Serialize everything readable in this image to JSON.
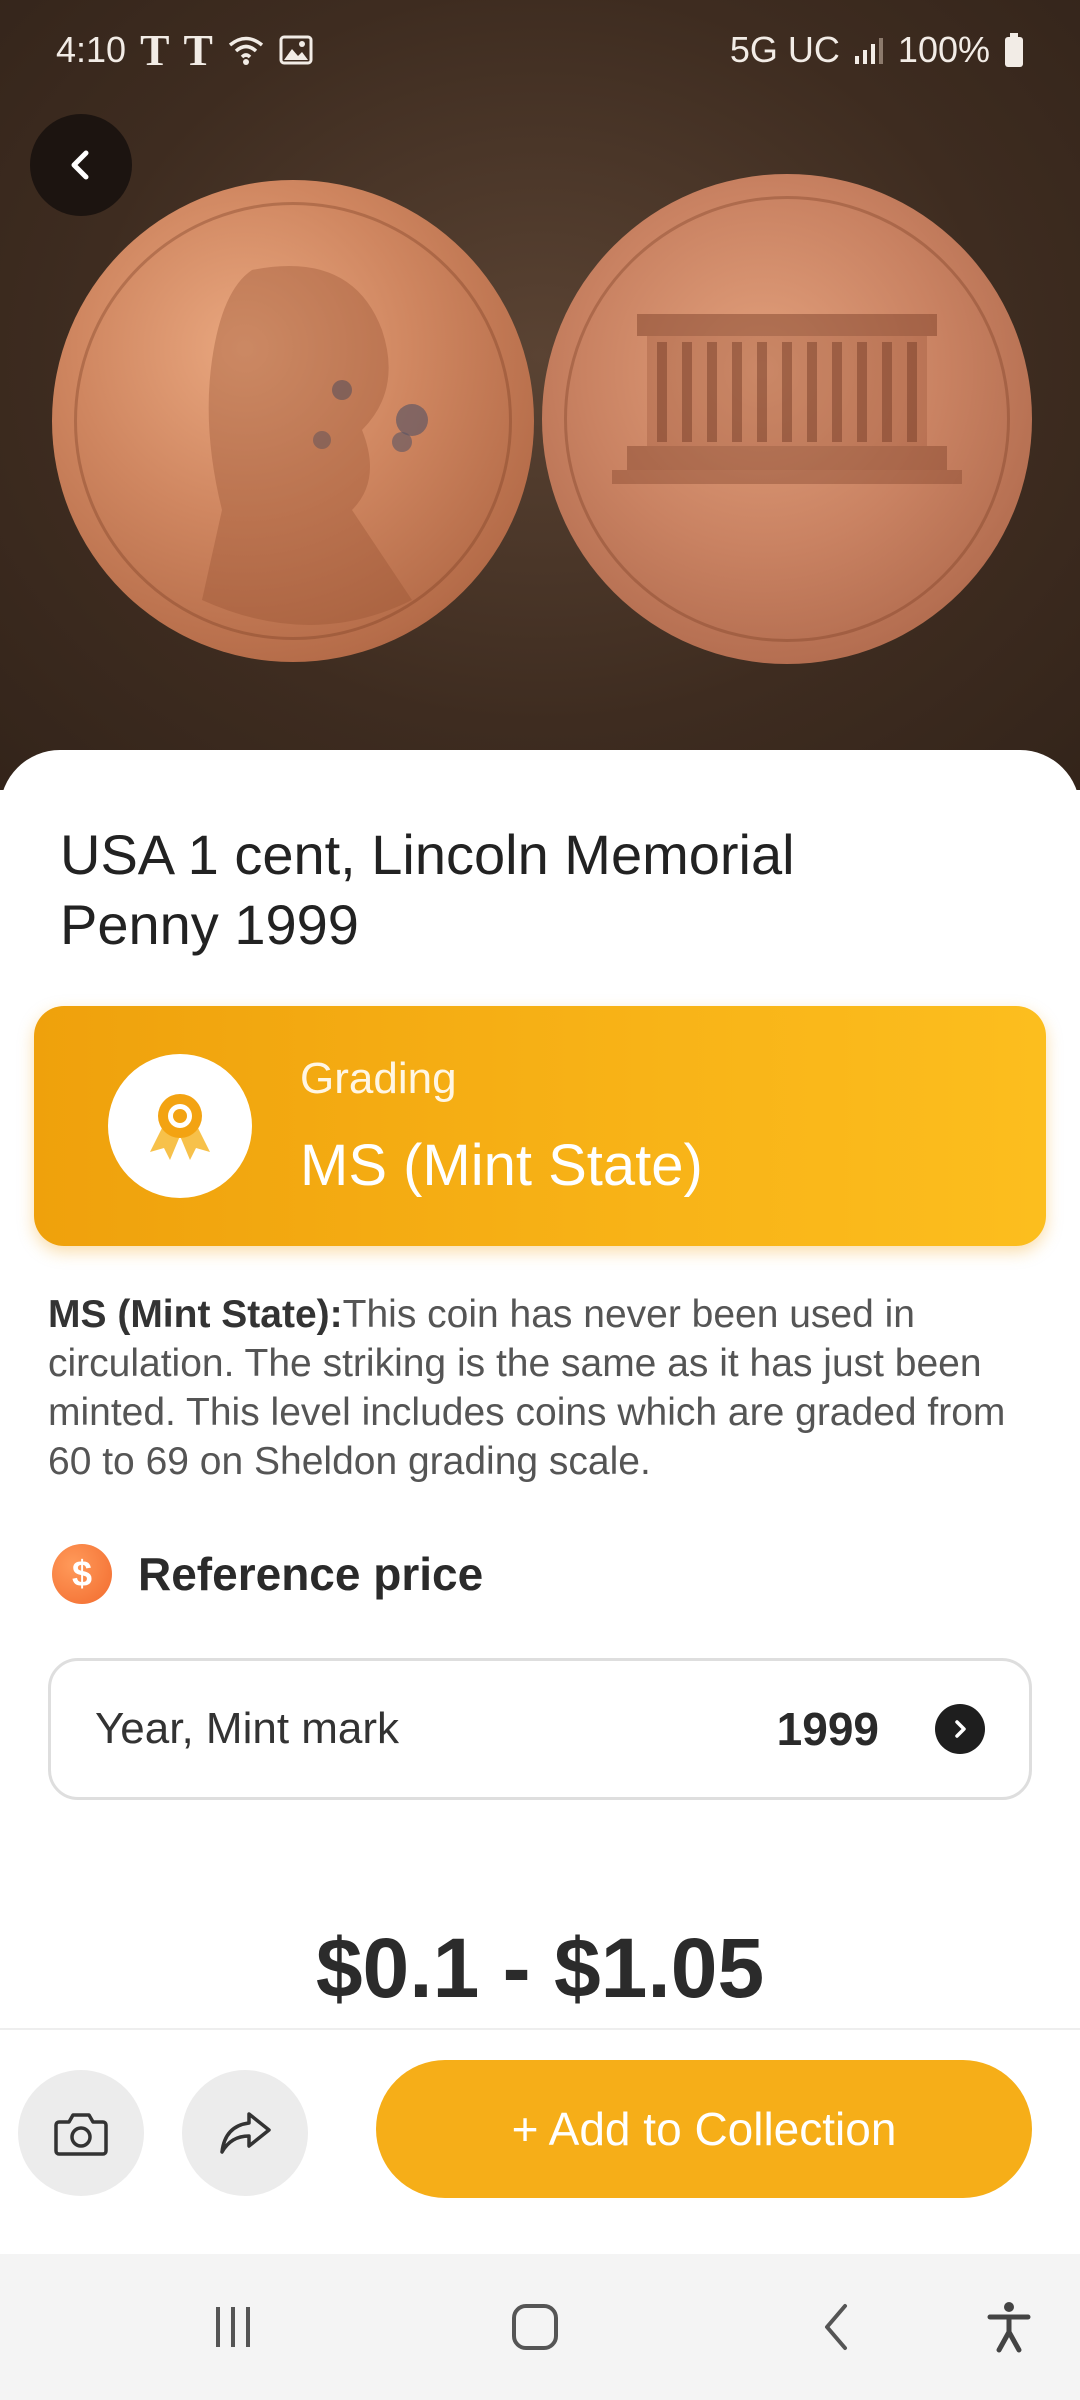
{
  "status_bar": {
    "time": "4:10",
    "carrier_glyph": "T",
    "network": "5G UC",
    "battery": "100%"
  },
  "coin": {
    "title": "USA 1 cent, Lincoln Memorial Penny 1999"
  },
  "grading": {
    "label": "Grading",
    "value": "MS (Mint State)"
  },
  "description": {
    "term": "MS (Mint State):",
    "text": "This coin has never been used in circulation. The striking is the same as it has just been minted. This level includes coins which are graded from 60 to 69 on Sheldon grading scale."
  },
  "reference_price": {
    "title": "Reference price",
    "icon_glyph": "$",
    "selector_label": "Year, Mint mark",
    "selector_value": "1999",
    "price_range": "$0.1 - $1.05"
  },
  "actions": {
    "add_label": "+ Add to Collection"
  },
  "icons": {
    "back": "back-arrow-icon",
    "camera": "camera-icon",
    "share": "share-icon",
    "medal": "medal-icon",
    "chevron": "chevron-right-icon"
  },
  "colors": {
    "accent": "#f6ae18",
    "grading_gradient_start": "#efa10c",
    "grading_gradient_end": "#fcbe1e",
    "dollar_icon": "#f26b2e"
  }
}
